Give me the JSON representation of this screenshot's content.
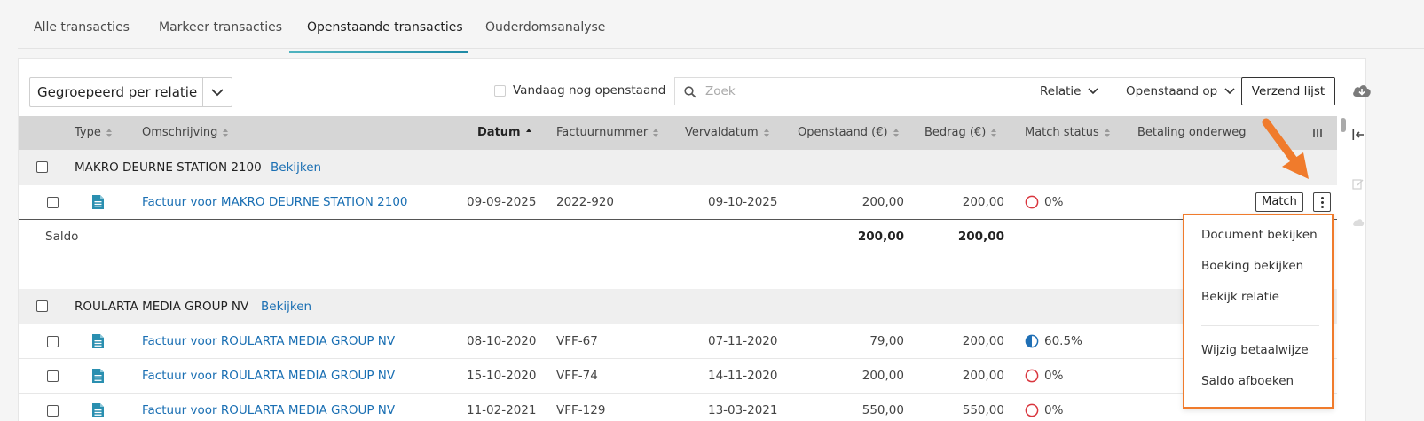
{
  "tabs": [
    {
      "label": "Alle transacties",
      "active": false
    },
    {
      "label": "Markeer transacties",
      "active": false
    },
    {
      "label": "Openstaande transacties",
      "active": true
    },
    {
      "label": "Ouderdomsanalyse",
      "active": false
    }
  ],
  "toolbar": {
    "group_by": "Gegroepeerd per relatie",
    "today_checkbox_label": "Vandaag nog openstaand",
    "search_placeholder": "Zoek",
    "filter_relatie": "Relatie",
    "filter_openstaand": "Openstaand op",
    "send_button": "Verzend lijst"
  },
  "columns": [
    "Type",
    "Omschrijving",
    "Datum",
    "Factuurnummer",
    "Vervaldatum",
    "Openstaand (€)",
    "Bedrag (€)",
    "Match status",
    "Betaling onderweg"
  ],
  "groups": [
    {
      "name": "MAKRO DEURNE STATION 2100",
      "view_link": "Bekijken",
      "rows": [
        {
          "description": "Factuur voor MAKRO DEURNE STATION 2100",
          "date": "09-09-2025",
          "invoice": "2022-920",
          "due": "09-10-2025",
          "open": "200,00",
          "amount": "200,00",
          "match": "0%",
          "match_fraction": 0,
          "match_button": "Match"
        }
      ],
      "saldo": {
        "label": "Saldo",
        "open": "200,00",
        "amount": "200,00"
      }
    },
    {
      "name": "ROULARTA MEDIA GROUP NV",
      "view_link": "Bekijken",
      "rows": [
        {
          "description": "Factuur voor ROULARTA MEDIA GROUP NV",
          "date": "08-10-2020",
          "invoice": "VFF-67",
          "due": "07-11-2020",
          "open": "79,00",
          "amount": "200,00",
          "match": "60.5%",
          "match_fraction": 0.605
        },
        {
          "description": "Factuur voor ROULARTA MEDIA GROUP NV",
          "date": "15-10-2020",
          "invoice": "VFF-74",
          "due": "14-11-2020",
          "open": "200,00",
          "amount": "200,00",
          "match": "0%",
          "match_fraction": 0
        },
        {
          "description": "Factuur voor ROULARTA MEDIA GROUP NV",
          "date": "11-02-2021",
          "invoice": "VFF-129",
          "due": "13-03-2021",
          "open": "550,00",
          "amount": "550,00",
          "match": "0%",
          "match_fraction": 0
        }
      ]
    }
  ],
  "context_menu": {
    "items": [
      "Document bekijken",
      "Boeking bekijken",
      "Bekijk relatie",
      "Wijzig betaalwijze",
      "Saldo afboeken"
    ]
  },
  "colors": {
    "link": "#1a6fb3",
    "accent_orange": "#f07b2c",
    "doc_icon": "#2a8fb0",
    "status_red": "#d9363e",
    "status_blue": "#1f6fb5"
  }
}
